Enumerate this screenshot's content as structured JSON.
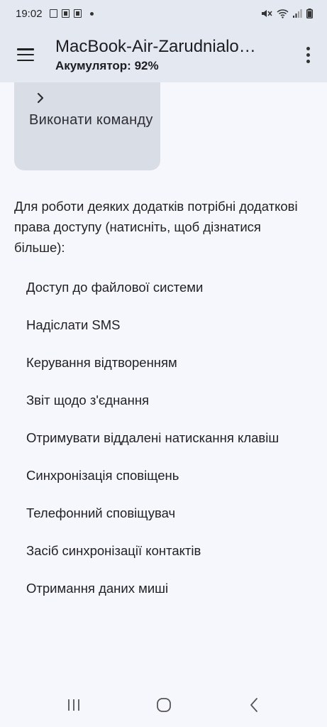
{
  "status_bar": {
    "time": "19:02"
  },
  "app_bar": {
    "title": "MacBook-Air-Zarudnialo…",
    "subtitle": "Акумулятор: 92%"
  },
  "command_card": {
    "label": "Виконати команду"
  },
  "info_text": "Для роботи деяких додатків потрібні додаткові права доступу (натисніть, щоб дізнатися більше):",
  "permissions": [
    "Доступ до файлової системи",
    "Надіслати SMS",
    "Керування відтворенням",
    "Звіт щодо з'єднання",
    "Отримувати віддалені натискання клавіш",
    "Синхронізація сповіщень",
    "Телефонний сповіщувач",
    "Засіб синхронізації контактів",
    "Отримання даних миші"
  ],
  "colors": {
    "app_bar_background": "#e3e8f1",
    "page_background": "#f6f7fc",
    "card_background": "#d9dde5"
  }
}
